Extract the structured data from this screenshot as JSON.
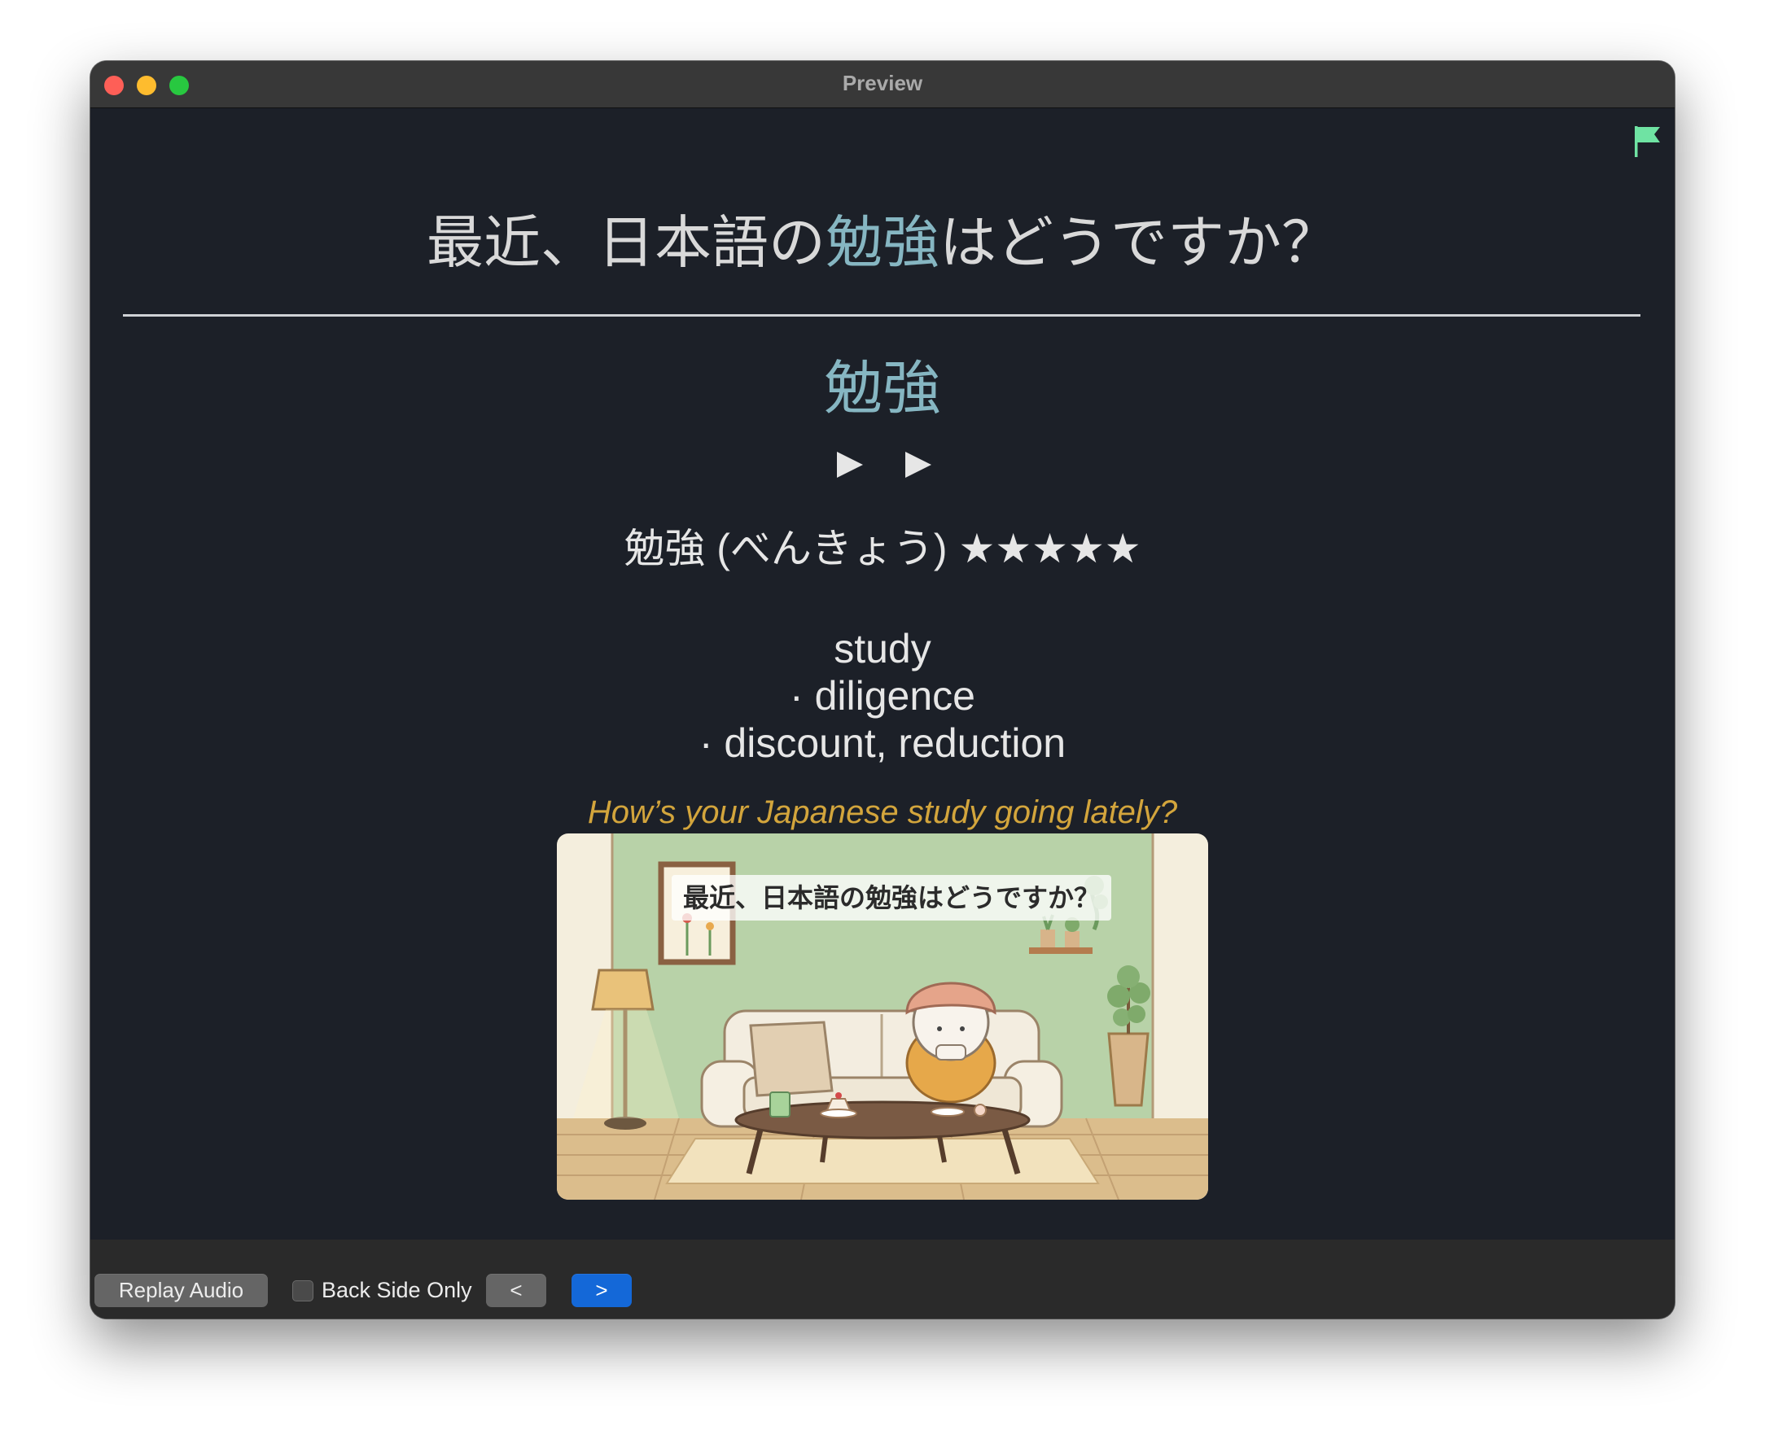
{
  "window": {
    "title": "Preview"
  },
  "card": {
    "sentence_before": "最近、日本語の",
    "sentence_highlight": "勉強",
    "sentence_after": "はどうですか？",
    "word": "勉強",
    "reading": "勉強 (べんきょう) ★★★★★",
    "definitions": [
      "study",
      "· diligence",
      "· discount, reduction"
    ],
    "translation": "How’s your Japanese study going lately?",
    "image_caption": "最近、日本語の勉強はどうですか？"
  },
  "toolbar": {
    "replay_label": "Replay Audio",
    "back_side_label": "Back Side Only",
    "back_side_checked": false,
    "prev_label": "<",
    "next_label": ">"
  },
  "colors": {
    "background": "#1c2028",
    "highlight": "#86b6c2",
    "translation": "#d3a53c",
    "flag": "#6fe3a3",
    "next_button": "#1468d8"
  },
  "icons": {
    "flag": "flag-icon",
    "play": "play-icon"
  }
}
